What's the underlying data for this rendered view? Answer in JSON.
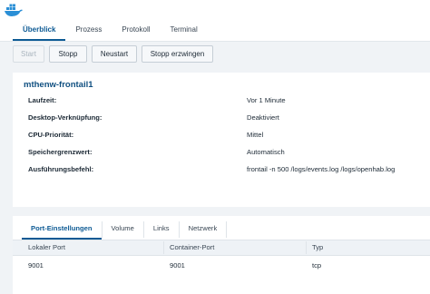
{
  "tabs": [
    {
      "label": "Überblick",
      "active": true
    },
    {
      "label": "Prozess",
      "active": false
    },
    {
      "label": "Protokoll",
      "active": false
    },
    {
      "label": "Terminal",
      "active": false
    }
  ],
  "actions": {
    "start": "Start",
    "stop": "Stopp",
    "restart": "Neustart",
    "force_stop": "Stopp erzwingen"
  },
  "details": {
    "title": "mthenw-frontail1",
    "rows": [
      {
        "label": "Laufzeit:",
        "value": "Vor 1 Minute"
      },
      {
        "label": "Desktop-Verknüpfung:",
        "value": "Deaktiviert"
      },
      {
        "label": "CPU-Priorität:",
        "value": "Mittel"
      },
      {
        "label": "Speichergrenzwert:",
        "value": "Automatisch"
      },
      {
        "label": "Ausführungsbefehl:",
        "value": "frontail -n 500 /logs/events.log /logs/openhab.log"
      }
    ]
  },
  "subtabs": [
    {
      "label": "Port-Einstellungen",
      "active": true
    },
    {
      "label": "Volume",
      "active": false
    },
    {
      "label": "Links",
      "active": false
    },
    {
      "label": "Netzwerk",
      "active": false
    }
  ],
  "port_table": {
    "headers": [
      "Lokaler Port",
      "Container-Port",
      "Typ"
    ],
    "rows": [
      [
        "9001",
        "9001",
        "tcp"
      ]
    ]
  },
  "colors": {
    "accent": "#0d5a94",
    "title": "#0f4f80",
    "app_icon": "#2a8fd6"
  },
  "icons": {
    "app": "docker-whale-icon"
  }
}
